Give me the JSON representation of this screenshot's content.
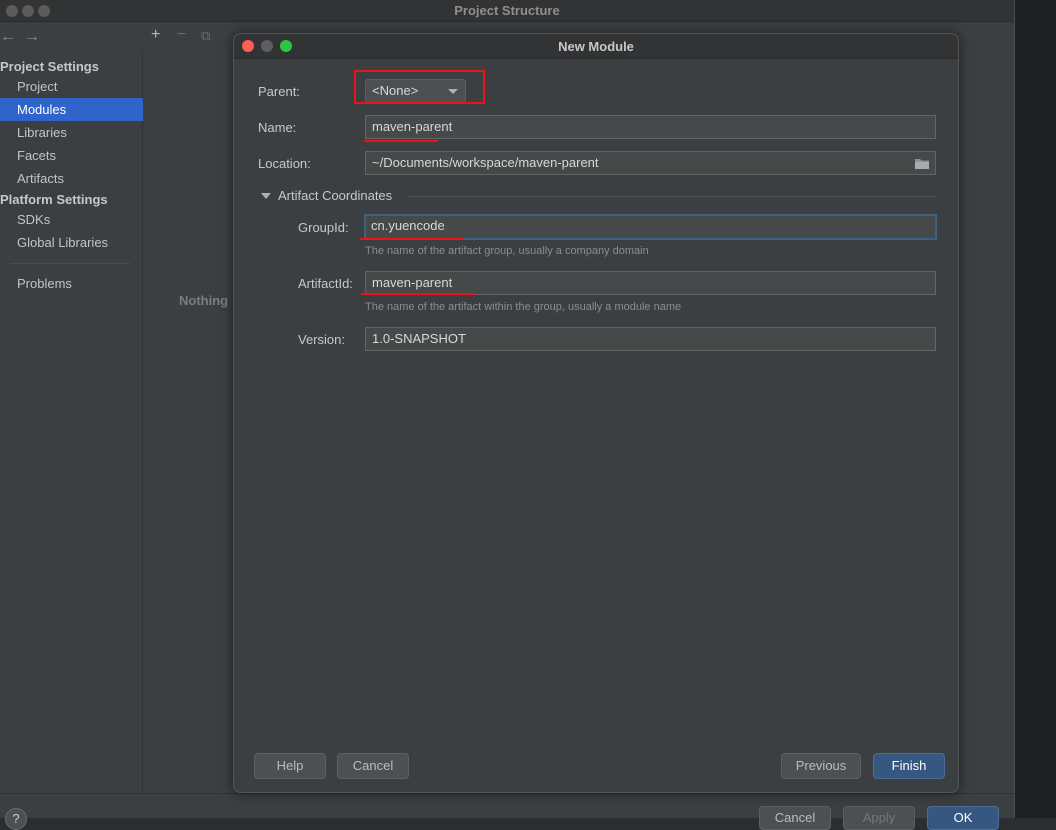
{
  "outer": {
    "title": "Project Structure",
    "nav_back": "←",
    "nav_forward": "→",
    "toolbar": {
      "add": "+",
      "remove": "−",
      "copy": "⧉"
    },
    "sidebar": {
      "project_settings_header": "Project Settings",
      "project_items": [
        "Project",
        "Modules",
        "Libraries",
        "Facets",
        "Artifacts"
      ],
      "selected": "Modules",
      "platform_settings_header": "Platform Settings",
      "platform_items": [
        "SDKs",
        "Global Libraries"
      ],
      "problems": "Problems"
    },
    "empty_text": "Nothing",
    "help_label": "?",
    "buttons": {
      "cancel": "Cancel",
      "apply": "Apply",
      "ok": "OK"
    }
  },
  "dialog": {
    "title": "New Module",
    "parent": {
      "label": "Parent:",
      "value": "<None>"
    },
    "name": {
      "label": "Name:",
      "value": "maven-parent"
    },
    "location": {
      "label": "Location:",
      "value": "~/Documents/workspace/maven-parent"
    },
    "artifact_section": "Artifact Coordinates",
    "groupid": {
      "label": "GroupId:",
      "value": "cn.yuencode",
      "hint": "The name of the artifact group, usually a company domain"
    },
    "artifactid": {
      "label": "ArtifactId:",
      "value": "maven-parent",
      "hint": "The name of the artifact within the group, usually a module name"
    },
    "version": {
      "label": "Version:",
      "value": "1.0-SNAPSHOT"
    },
    "buttons": {
      "help": "Help",
      "cancel": "Cancel",
      "previous": "Previous",
      "finish": "Finish"
    }
  },
  "colors": {
    "accent": "#2f65ca",
    "annotation": "#e8131b",
    "primary_button": "#365880"
  }
}
